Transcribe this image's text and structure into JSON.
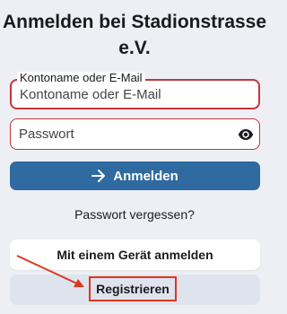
{
  "page": {
    "title": "Anmelden bei Stadionstrasse e.V."
  },
  "form": {
    "username": {
      "label": "Kontoname oder E-Mail",
      "placeholder": "Kontoname oder E-Mail",
      "value": ""
    },
    "password": {
      "placeholder": "Passwort",
      "value": "",
      "toggle_icon": "eye-icon"
    },
    "submit_label": "Anmelden",
    "submit_icon": "arrow-right-icon"
  },
  "links": {
    "forgot_password": "Passwort vergessen?"
  },
  "alternate": {
    "device_login_label": "Mit einem Gerät anmelden",
    "register_label": "Registrieren"
  },
  "colors": {
    "background": "#eeeff4",
    "primary": "#2f6aa0",
    "error_border": "#c2353d",
    "annotation": "#d9381e"
  }
}
